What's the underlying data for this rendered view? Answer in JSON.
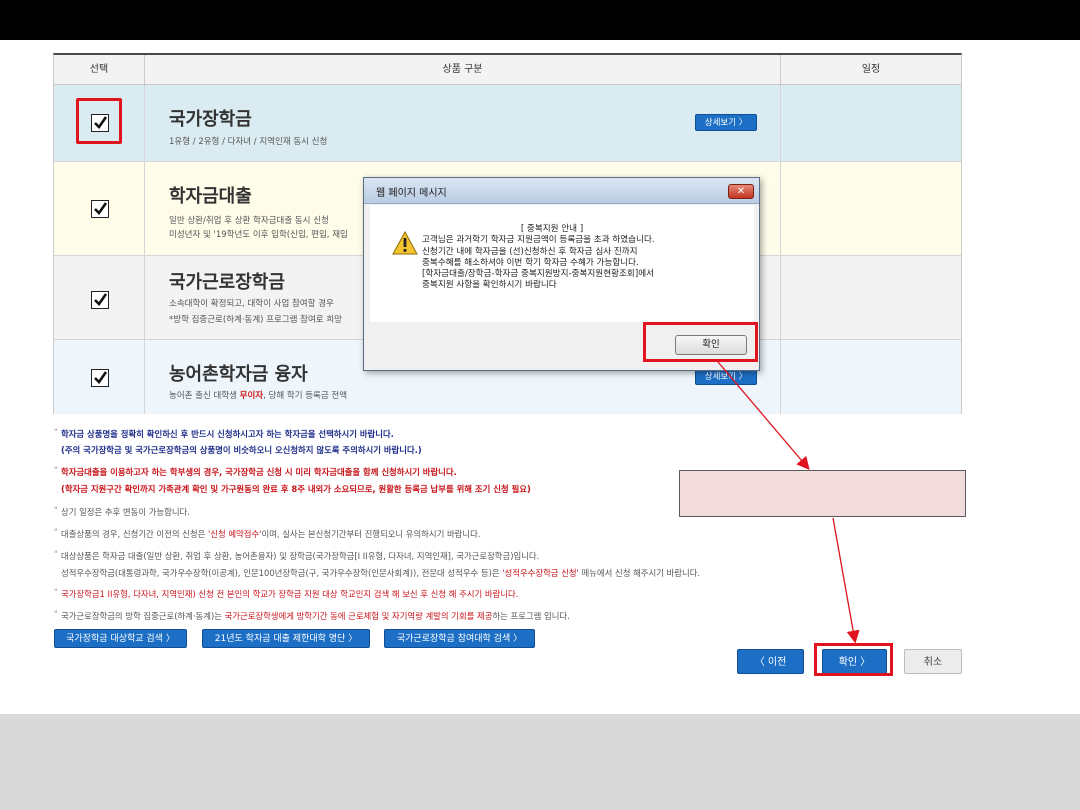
{
  "table": {
    "headers": {
      "select": "선택",
      "product": "상품 구분",
      "schedule": "일정"
    },
    "rows": [
      {
        "title": "국가장학금",
        "sub1": "1유형 / 2유형 / 다자녀 / 지역인재 동시 신청",
        "sub2": "",
        "detail": "상세보기 〉",
        "checked": true,
        "bg": "#daecf2"
      },
      {
        "title": "학자금대출",
        "sub1": "일반 상환/취업 후 상환 학자금대출 동시 신청",
        "sub2": "미성년자 및 '19학년도 이후 입학(신입, 편입, 재입",
        "detail": "",
        "checked": true,
        "bg": "#fffcea"
      },
      {
        "title": "국가근로장학금",
        "sub1": "소속대학이 확정되고, 대학이 사업 참여할 경우",
        "sub2": "*방학 집중근로(하계·동계) 프로그램 참여로 희망",
        "detail": "",
        "checked": true,
        "bg": "#f3f3f3"
      },
      {
        "title": "농어촌학자금 융자",
        "sub1_pre": "농어촌 출신 대학생 ",
        "sub1_red": "무이자",
        "sub1_post": ", 당해 학기 등록금 전액",
        "detail": "상세보기 〉",
        "checked": true,
        "bg": "#eef6fb"
      }
    ]
  },
  "dialog": {
    "title": "웹 페이지 메시지",
    "close": "✕",
    "heading": "[ 중복지원 안내 ]",
    "lines": [
      "고객님은 과거학기 학자금 지원금액이 등록금을 초과 하였습니다.",
      "신청기간 내에 학자금을 (선)신청하신 후 학자금 심사 진까지",
      "중복수혜를 해소하셔야 이번 학기 학자금 수혜가 가능합니다.",
      "[학자금대출/장학금-학자금 중복지원방지-중복지원현황조회]에서",
      "중복지원 사항을 확인하시기 바랍니다"
    ],
    "ok": "확인"
  },
  "notes": {
    "n1a": "학자금 상품명을 정확히 확인하신 후 반드시 신청하시고자 하는 학자금을 선택하시기 바랍니다.",
    "n1b": "(주의 국가장학금 및 국가근로장학금의 상품명이 비슷하오니 오신청하지 않도록 주의하시기 바랍니다.)",
    "n2a": "학자금대출을 이용하고자 하는 학부생의 경우, 국가장학금 신청 시 미리 학자금대출을 함께 신청하시기 바랍니다.",
    "n2b": "(학자금 지원구간 확인까지 가족관계 확인 및 가구원동의 완료 후 8주 내외가 소요되므로, 원활한 등록금 납부를 위해 조기 신청 필요)",
    "n3": "상기 일정은 추후 변동이 가능합니다.",
    "n4_pre": "대출상품의 경우, 신청기간 이전의 신청은 ",
    "n4_red": "'신청 예약접수'",
    "n4_post": "이며, 실사는 본신청기간부터 진행되오니 유의하시기 바랍니다.",
    "n5a": "대상상품은 학자금 대출(일반 상환, 취업 후 상환, 농어촌융자) 및 장학금(국가장학금[I II유형, 다자녀, 지역인재], 국가근로장학금)입니다.",
    "n5b_pre": "성적우수장학금(대통령과학, 국가우수장학(이공계), 인문100년장학금(구, 국가우수장학(인문사회계)), 전문대 성적우수 등)은 ",
    "n5b_red": "'성적우수장학금 신청'",
    "n5b_post": " 메뉴에서 신청 해주시기 바랍니다.",
    "n6": "국가장학금1 II유형, 다자녀, 지역인재) 신청 전 본인의 학교가 장학금 지원 대상 학교인지 검색 해 보신 후 신청 해 주시기 바랍니다.",
    "n7_pre": "국가근로장학금의 방학 집중근로(하계·동계)는 ",
    "n7_red": "국가근로장학생에게 방학기간 동에 근로체험 및 자기역량 계발의 기회를 제공",
    "n7_post": "하는 프로그램 입니다."
  },
  "links": {
    "l1": "국가장학금 대상학교 검색 〉",
    "l2": "21년도 학자금 대출 제한대학 명단 〉",
    "l3": "국가근로장학금 참여대학 검색 〉"
  },
  "buttons": {
    "prev": "〈  이전",
    "ok": "확인  〉",
    "cancel": "취소"
  },
  "colors": {
    "accent": "#1d6fc6",
    "highlight": "#e0141e",
    "note_navy": "#1f2e8a",
    "note_red": "#c8141a"
  }
}
